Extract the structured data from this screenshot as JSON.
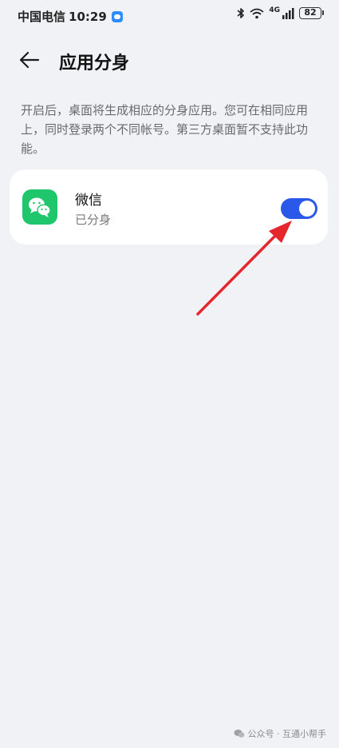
{
  "status_bar": {
    "carrier": "中国电信",
    "time": "10:29",
    "network_label": "4G",
    "battery": "82"
  },
  "header": {
    "title": "应用分身"
  },
  "description": "开启后，桌面将生成相应的分身应用。您可在相同应用上，同时登录两个不同帐号。第三方桌面暂不支持此功能。",
  "apps": [
    {
      "name": "微信",
      "status": "已分身",
      "enabled": true,
      "icon": "wechat-icon"
    }
  ],
  "colors": {
    "background": "#f1f2f6",
    "toggle_on": "#2a58e8",
    "wechat_green": "#1fc66b",
    "annotation_arrow": "#e5262c"
  },
  "watermark": {
    "text": "公众号 · 互通小帮手"
  }
}
